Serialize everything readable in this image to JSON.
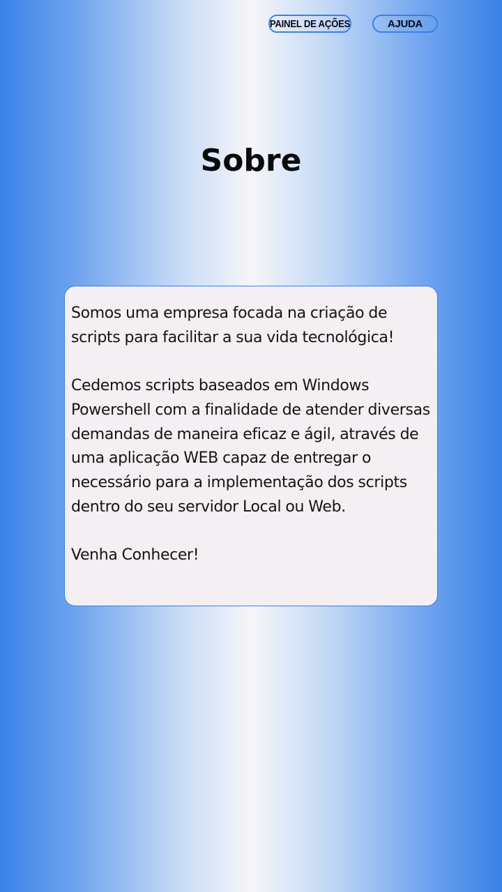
{
  "nav": {
    "painel_label": "PAINEL DE AÇÕES",
    "ajuda_label": "AJUDA"
  },
  "page": {
    "title": "Sobre"
  },
  "about": {
    "paragraphs": [
      "Somos uma empresa focada na criação de scripts para facilitar a sua vida tecnológica!",
      "Cedemos scripts baseados em Windows Powershell com a finalidade de atender diversas demandas de maneira eficaz e ágil, através de uma aplicação WEB capaz de entregar o necessário para a implementação dos scripts dentro do seu servidor Local ou Web.",
      "Venha Conhecer!"
    ]
  },
  "colors": {
    "accent": "#3b7fe3",
    "card_background": "#f3eff3",
    "gradient_edge": "#3a82e8",
    "gradient_center": "#f6f6f9"
  }
}
